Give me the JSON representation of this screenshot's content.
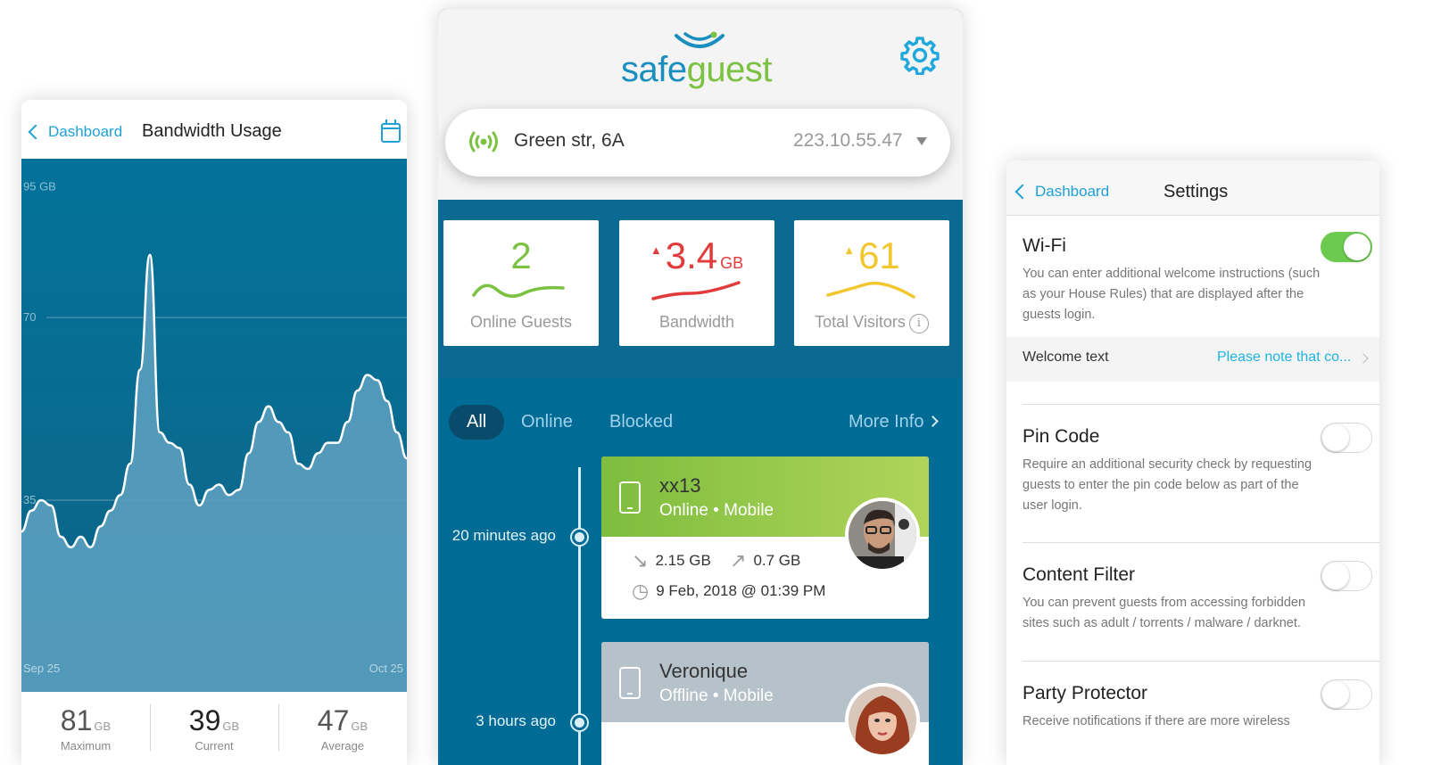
{
  "bandwidth": {
    "back_label": "Dashboard",
    "title": "Bandwidth Usage",
    "icons": {
      "back": "chevron-left-icon",
      "calendar": "calendar-icon"
    },
    "stats": [
      {
        "value": "81",
        "unit": "GB",
        "label": "Maximum"
      },
      {
        "value": "39",
        "unit": "GB",
        "label": "Current"
      },
      {
        "value": "47",
        "unit": "GB",
        "label": "Average"
      }
    ]
  },
  "chart_data": {
    "type": "area",
    "title": "",
    "xlabel": "",
    "ylabel": "",
    "y_tick_labels": [
      "95 GB",
      "70",
      "35"
    ],
    "y_ticks": [
      95,
      70,
      35
    ],
    "ylim": [
      0,
      97
    ],
    "x_tick_labels": [
      "Sep 25",
      "Oct 25"
    ],
    "grid": true,
    "series": [
      {
        "values": [
          29,
          33,
          35,
          34,
          28,
          26,
          28,
          26,
          30,
          33,
          36,
          42,
          60,
          82,
          48,
          46,
          45,
          38,
          34,
          37,
          38,
          36,
          37,
          44,
          50,
          53,
          50,
          48,
          42,
          41,
          44,
          46,
          46,
          50,
          56,
          59,
          58,
          54,
          48,
          43
        ]
      }
    ],
    "colors": {
      "fill": "#5a9fbf",
      "line": "#ffffff",
      "background": "#036f96"
    }
  },
  "dashboard": {
    "logo": {
      "part1": "safe",
      "part2": "guest"
    },
    "icons": {
      "settings": "gear-icon",
      "location": "wifi-signal-icon",
      "dropdown": "caret-down-icon"
    },
    "location": {
      "name": "Green str, 6A",
      "ip": "223.10.55.47"
    },
    "cards": [
      {
        "value": "2",
        "unit": "",
        "caption": "Online Guests",
        "color": "#7cc242",
        "alert": ""
      },
      {
        "value": "3.4",
        "unit": "GB",
        "caption": "Bandwidth",
        "color": "#e23b3b",
        "alert": "▲"
      },
      {
        "value": "61",
        "unit": "",
        "caption": "Total Visitors",
        "color": "#f2c62f",
        "alert": "▲",
        "info": "i"
      }
    ],
    "tabs": [
      "All",
      "Online",
      "Blocked"
    ],
    "more_info": "More Info",
    "guests": [
      {
        "time": "20 minutes ago",
        "name": "xx13",
        "status": "Online",
        "device": "Mobile",
        "download": "2.15 GB",
        "upload": "0.7 GB",
        "date": "9 Feb, 2018 @ 01:39 PM"
      },
      {
        "time": "3 hours ago",
        "name": "Veronique",
        "status": "Offline",
        "device": "Mobile"
      }
    ]
  },
  "settings": {
    "back_label": "Dashboard",
    "title": "Settings",
    "sections": [
      {
        "title": "Wi-Fi",
        "enabled": true,
        "description": "You can enter additional welcome instructions (such as your House Rules) that are displayed after the guests login."
      },
      {
        "title": "Pin Code",
        "enabled": false,
        "description": "Require an additional security check by requesting guests to enter the pin code below as part of the user login."
      },
      {
        "title": "Content Filter",
        "enabled": false,
        "description": "You can prevent guests from accessing forbidden sites such as adult / torrents / malware / darknet."
      },
      {
        "title": "Party Protector",
        "enabled": false,
        "description": "Receive notifications if there are more wireless"
      }
    ],
    "welcome": {
      "label": "Welcome text",
      "value": "Please note that co..."
    }
  }
}
